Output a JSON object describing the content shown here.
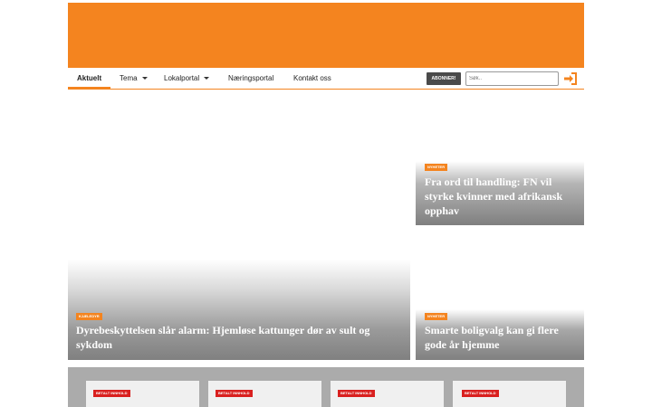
{
  "nav": {
    "items": [
      {
        "label": "Aktuelt"
      },
      {
        "label": "Tema"
      },
      {
        "label": "Lokalportal"
      },
      {
        "label": "Næringsportal"
      },
      {
        "label": "Kontakt oss"
      }
    ],
    "subscribe_label": "ABONNER!",
    "search_placeholder": "Søk..",
    "login_icon": "sign-in-icon"
  },
  "articles": [
    {
      "badge": "NYHETER",
      "title": "Fra ord til handling: FN vil styrke kvinner med afrikansk opphav"
    },
    {
      "badge": "KJÆLEDYR",
      "title": "Dyrebeskyttelsen slår alarm: Hjemløse kattunger dør av sult og sykdom"
    },
    {
      "badge": "NYHETER",
      "title": "Smarte boligvalg kan gi flere gode år hjemme"
    }
  ],
  "paid": [
    {
      "badge": "BETALT INNHOLD"
    },
    {
      "badge": "BETALT INNHOLD"
    },
    {
      "badge": "BETALT INNHOLD"
    },
    {
      "badge": "BETALT INNHOLD"
    }
  ],
  "colors": {
    "brand": "#f4841f",
    "paid_badge": "#d9201f",
    "nav_button": "#4a4a4a"
  }
}
